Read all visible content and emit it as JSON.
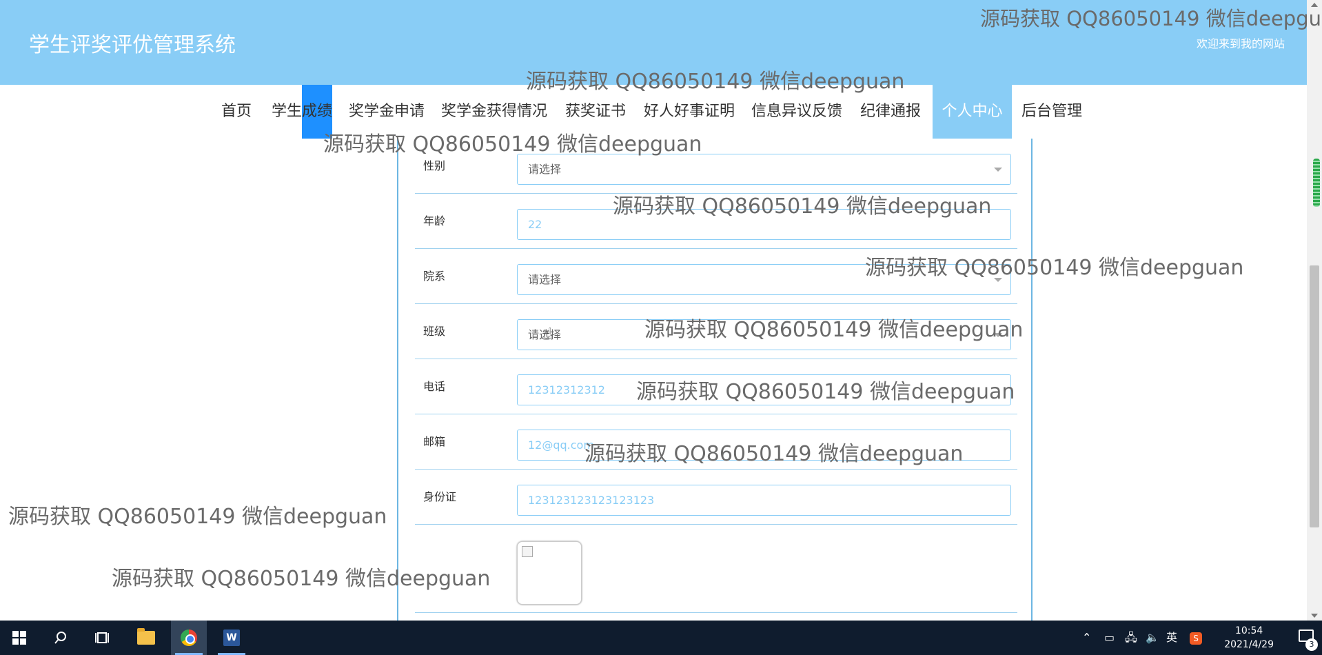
{
  "header": {
    "title": "学生评奖评优管理系统",
    "welcome": "欢迎来到我的网站"
  },
  "nav": {
    "items": [
      {
        "label": "首页"
      },
      {
        "label": "学生成绩"
      },
      {
        "label": "奖学金申请"
      },
      {
        "label": "奖学金获得情况"
      },
      {
        "label": "获奖证书"
      },
      {
        "label": "好人好事证明"
      },
      {
        "label": "信息异议反馈"
      },
      {
        "label": "纪律通报"
      },
      {
        "label": "个人中心",
        "active": true
      },
      {
        "label": "后台管理"
      }
    ]
  },
  "form": {
    "gender": {
      "label": "性别",
      "placeholder": "请选择"
    },
    "age": {
      "label": "年龄",
      "value": "22"
    },
    "department": {
      "label": "院系",
      "placeholder": "请选择"
    },
    "class": {
      "label": "班级",
      "placeholder": "请选择"
    },
    "phone": {
      "label": "电话",
      "value": "12312312312"
    },
    "email": {
      "label": "邮箱",
      "value": "12@qq.com"
    },
    "id_card": {
      "label": "身份证",
      "value": "123123123123123123"
    }
  },
  "watermark": {
    "text": "源码获取 QQ86050149 微信deepguan",
    "text_clipped": "源码获取 QQ86050149 微信deepgu"
  },
  "taskbar": {
    "ime": "英",
    "time": "10:54",
    "date": "2021/4/29",
    "notification_count": "3"
  },
  "colors": {
    "header_bg": "#89cdf6",
    "active_nav": "#89cdf6",
    "highlight": "#1e90ff",
    "field_border": "#89cdf6",
    "taskbar_bg": "#0f1c2e"
  }
}
